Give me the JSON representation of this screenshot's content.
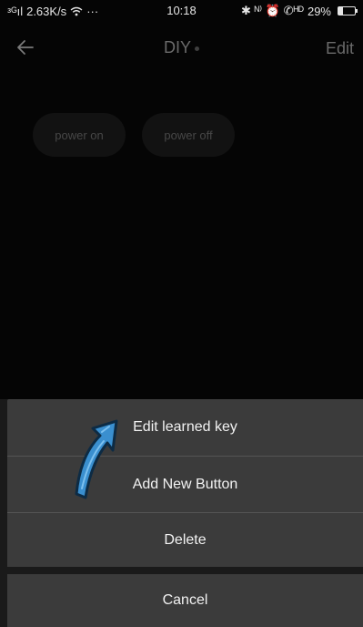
{
  "status_bar": {
    "signal_text": "ᵌᴳıl",
    "speed": "2.63K/s",
    "wifi_icon": "wifi-icon",
    "more": "···",
    "time": "10:18",
    "right_icons": "✱ ᴺ⁾ ⏰ ✆ᴴᴰ",
    "battery_percent": "29%",
    "battery_level": 0.29
  },
  "app_bar": {
    "title": "DIY",
    "edit_label": "Edit"
  },
  "keys": [
    {
      "label": "power on"
    },
    {
      "label": "power off"
    }
  ],
  "action_sheet": {
    "items": [
      {
        "label": "Edit learned key"
      },
      {
        "label": "Add New Button"
      },
      {
        "label": "Delete"
      }
    ],
    "cancel_label": "Cancel"
  },
  "colors": {
    "sheet_item": "#3b3b3b",
    "arrow": "#3a8fcf",
    "background": "#050505"
  }
}
